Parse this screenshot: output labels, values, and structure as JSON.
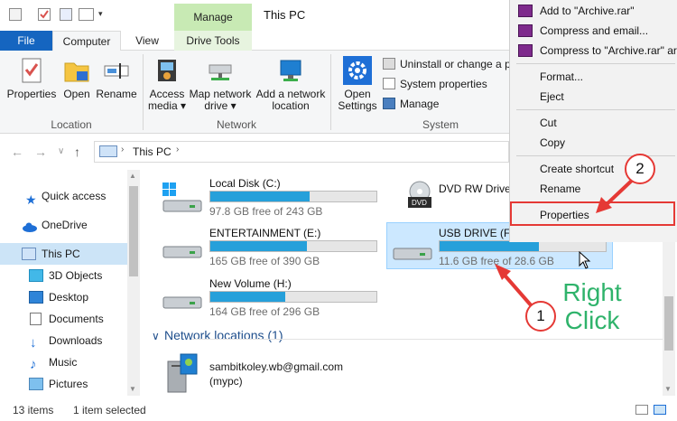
{
  "window": {
    "title": "This PC",
    "manage_tab": "Manage"
  },
  "tabs": {
    "file": "File",
    "computer": "Computer",
    "view": "View",
    "drive_tools": "Drive Tools"
  },
  "ribbon": {
    "location": {
      "label": "Location",
      "properties": "Properties",
      "open": "Open",
      "rename": "Rename"
    },
    "network": {
      "label": "Network",
      "access_media_1": "Access",
      "access_media_2": "media",
      "map_drive_1": "Map network",
      "map_drive_2": "drive",
      "add_location_1": "Add a network",
      "add_location_2": "location"
    },
    "system": {
      "label": "System",
      "open_settings_1": "Open",
      "open_settings_2": "Settings",
      "uninstall": "Uninstall or change a p",
      "system_properties": "System properties",
      "manage": "Manage"
    }
  },
  "address": {
    "crumb": "This PC"
  },
  "sidebar": {
    "items": [
      {
        "label": "Quick access"
      },
      {
        "label": "OneDrive"
      },
      {
        "label": "This PC"
      },
      {
        "label": "3D Objects"
      },
      {
        "label": "Desktop"
      },
      {
        "label": "Documents"
      },
      {
        "label": "Downloads"
      },
      {
        "label": "Music"
      },
      {
        "label": "Pictures"
      }
    ]
  },
  "drives": [
    {
      "name": "Local Disk (C:)",
      "free": "97.8 GB free of 243 GB",
      "used_fraction": 0.6
    },
    {
      "name": "ENTERTAINMENT (E:)",
      "free": "165 GB free of 390 GB",
      "used_fraction": 0.58
    },
    {
      "name": "New Volume (H:)",
      "free": "164 GB free of 296 GB",
      "used_fraction": 0.45
    },
    {
      "name": "DVD RW Drive",
      "free": ""
    },
    {
      "name": "USB DRIVE (F:)",
      "free": "11.6 GB free of 28.6 GB",
      "used_fraction": 0.6
    }
  ],
  "network_locations": {
    "header": "Network locations (1)",
    "items": [
      {
        "line1": "sambitkoley.wb@gmail.com",
        "line2": "(mypc)"
      }
    ]
  },
  "context_menu": {
    "items": [
      "Add to \"Archive.rar\"",
      "Compress and email...",
      "Compress to \"Archive.rar\" ar",
      "Format...",
      "Eject",
      "Cut",
      "Copy",
      "Create shortcut",
      "Rename",
      "Properties"
    ]
  },
  "status": {
    "count": "13 items",
    "selected": "1 item selected"
  },
  "annotations": {
    "step1": "1",
    "step2": "2",
    "right": "Right",
    "click": "Click"
  },
  "colors": {
    "accent": "#1565c0",
    "bar_fill": "#26a0da",
    "annotation_red": "#e53935",
    "annotation_green": "#2fb36b",
    "manage_green": "#c8eab4"
  }
}
